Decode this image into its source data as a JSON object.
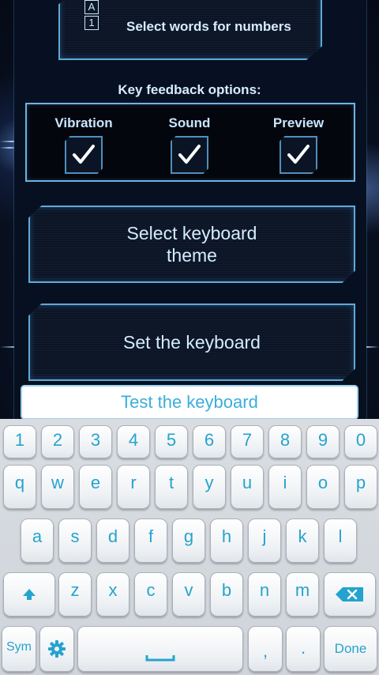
{
  "settings": {
    "select_words_label": "Select words for numbers",
    "select_words_icon_top": "A",
    "select_words_icon_bottom": "1",
    "feedback_title": "Key feedback options:",
    "feedback": [
      {
        "label": "Vibration",
        "checked": true
      },
      {
        "label": "Sound",
        "checked": true
      },
      {
        "label": "Preview",
        "checked": true
      }
    ],
    "theme_button_line1": "Select keyboard",
    "theme_button_line2": "theme",
    "set_keyboard_button": "Set the keyboard",
    "test_field_placeholder": "Test the keyboard"
  },
  "keyboard": {
    "row_numbers": [
      "1",
      "2",
      "3",
      "4",
      "5",
      "6",
      "7",
      "8",
      "9",
      "0"
    ],
    "row1": [
      "q",
      "w",
      "e",
      "r",
      "t",
      "y",
      "u",
      "i",
      "o",
      "p"
    ],
    "row2": [
      "a",
      "s",
      "d",
      "f",
      "g",
      "h",
      "j",
      "k",
      "l"
    ],
    "row3": [
      "z",
      "x",
      "c",
      "v",
      "b",
      "n",
      "m"
    ],
    "sym_label": "Sym",
    "comma_label": ",",
    "period_label": ".",
    "done_label": "Done",
    "icons": [
      "shift-icon",
      "backspace-icon",
      "gear-icon",
      "space-icon"
    ]
  },
  "colors": {
    "accent": "#25a3cf",
    "hud_border": "#5fa8d8",
    "hud_text": "#d7ecff"
  }
}
